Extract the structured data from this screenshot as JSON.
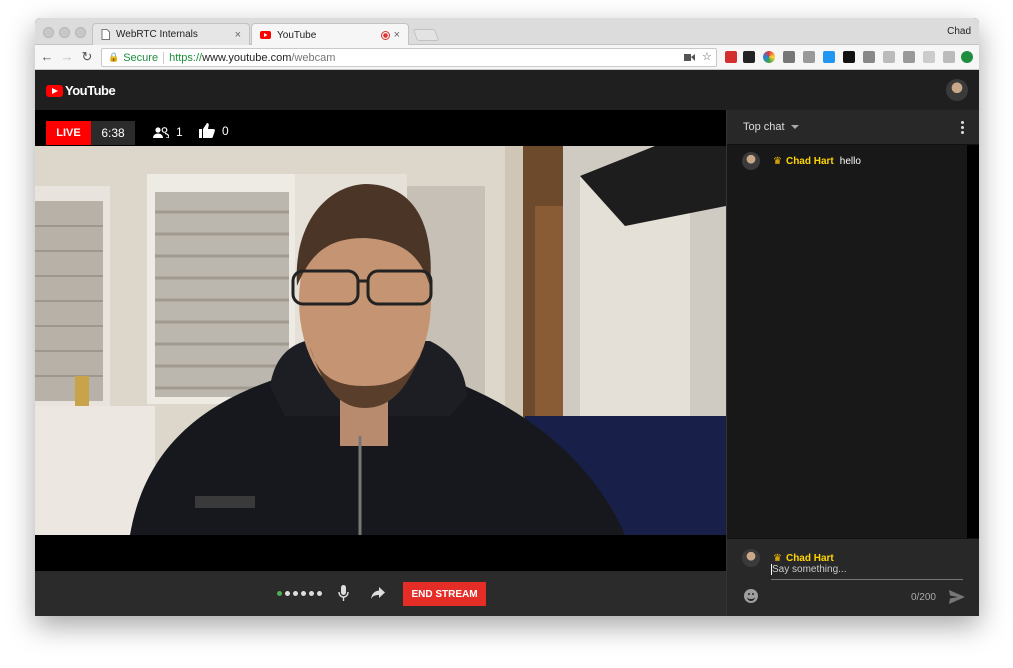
{
  "browser": {
    "profile_name": "Chad",
    "tabs": [
      {
        "title": "WebRTC Internals",
        "close": "×"
      },
      {
        "title": "YouTube",
        "close": "×"
      }
    ],
    "omnibox": {
      "secure_label": "Secure",
      "url_scheme": "https://",
      "url_host": "www.youtube.com",
      "url_path": "/webcam"
    },
    "extension_icons": [
      "adblock-icon",
      "buffer-icon",
      "colorzilla-icon",
      "mail-icon",
      "chat-icon",
      "screen-share-icon",
      "jb-icon",
      "grey-icon",
      "a-icon",
      "w-icon",
      "cloud-icon",
      "pen-icon",
      "arrow-up-icon"
    ]
  },
  "youtube": {
    "logo_text": "YouTube",
    "stream": {
      "live_label": "LIVE",
      "elapsed": "6:38",
      "viewers": "1",
      "likes": "0"
    },
    "controls": {
      "end_stream_label": "END STREAM",
      "signal_dots": 6
    },
    "chat": {
      "mode_label": "Top chat",
      "messages": [
        {
          "author": "Chad Hart",
          "text": "hello"
        }
      ],
      "input": {
        "author": "Chad Hart",
        "placeholder": "Say something...",
        "counter": "0/200"
      }
    }
  },
  "colors": {
    "live_red": "#ff0000",
    "end_stream_red": "#e52d27",
    "owner_gold": "#ffd600",
    "secure_green": "#1e8e3e"
  }
}
